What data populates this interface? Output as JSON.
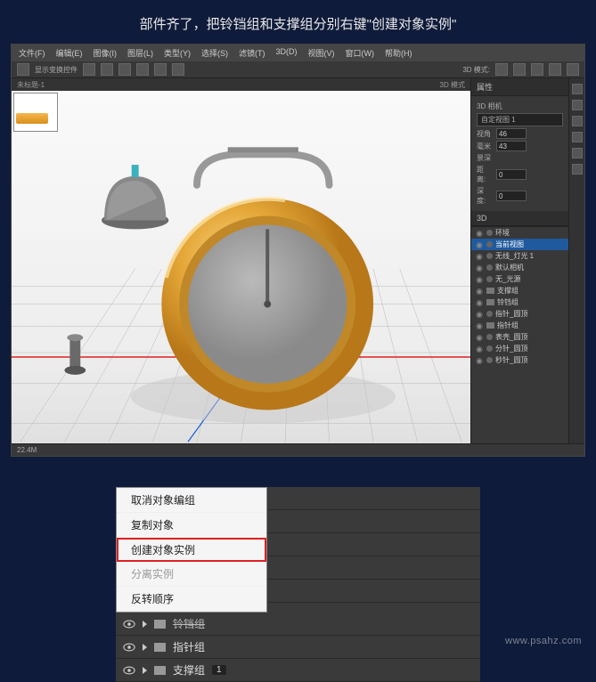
{
  "instruction": "部件齐了，把铃铛组和支撑组分别右键\"创建对象实例\"",
  "menubar": {
    "items": [
      "文件(F)",
      "编辑(E)",
      "图像(I)",
      "图层(L)",
      "类型(Y)",
      "选择(S)",
      "滤镜(T)",
      "3D(D)",
      "视图(V)",
      "窗口(W)",
      "帮助(H)"
    ]
  },
  "optionsbar": {
    "mode_label": "3D 模式:",
    "zoom_label": "显示变换控件"
  },
  "viewport_header": {
    "left": "未标题-1",
    "mode": "3D 模式"
  },
  "right_panel": {
    "header1": "属性",
    "camera_label": "3D 相机",
    "view_label": "自定视图 1",
    "fov_label": "视角",
    "fov_value": "46",
    "mm_label": "毫米",
    "mm_value": "43",
    "depth_label": "景深",
    "dist_label": "距离:",
    "dist_value": "0",
    "depth_val_label": "深度:",
    "depth_value": "0",
    "header_3d": "3D"
  },
  "layers_3d": [
    {
      "name": "环境",
      "type": "env",
      "indent": 0
    },
    {
      "name": "当前视图",
      "type": "cam",
      "indent": 0,
      "selected": true
    },
    {
      "name": "无线_灯光 1",
      "type": "light",
      "indent": 0
    },
    {
      "name": "默认相机",
      "type": "cam",
      "indent": 0
    },
    {
      "name": "无_光源",
      "type": "light",
      "indent": 0
    },
    {
      "name": "支撑组",
      "type": "folder",
      "indent": 0
    },
    {
      "name": "铃铛组",
      "type": "folder",
      "indent": 0
    },
    {
      "name": "指针_圆顶",
      "type": "mesh",
      "indent": 0
    },
    {
      "name": "指针组",
      "type": "folder",
      "indent": 0
    },
    {
      "name": "表壳_圆顶",
      "type": "mesh",
      "indent": 0
    },
    {
      "name": "分针_圆顶",
      "type": "mesh",
      "indent": 0
    },
    {
      "name": "秒针_圆顶",
      "type": "mesh",
      "indent": 0
    }
  ],
  "status": "22.4M",
  "context_menu": {
    "items": [
      {
        "label": "取消对象编组",
        "disabled": false
      },
      {
        "label": "复制对象",
        "disabled": false
      },
      {
        "label": "创建对象实例",
        "highlighted": true
      },
      {
        "label": "分离实例",
        "disabled": true
      },
      {
        "label": "反转顺序",
        "disabled": false
      }
    ]
  },
  "bottom_layers": [
    {
      "name": "铃铛组",
      "strike": true,
      "count": ""
    },
    {
      "name": "指针组",
      "count": ""
    },
    {
      "name": "支撑组",
      "count": "1"
    }
  ],
  "watermark": "www.psahz.com"
}
